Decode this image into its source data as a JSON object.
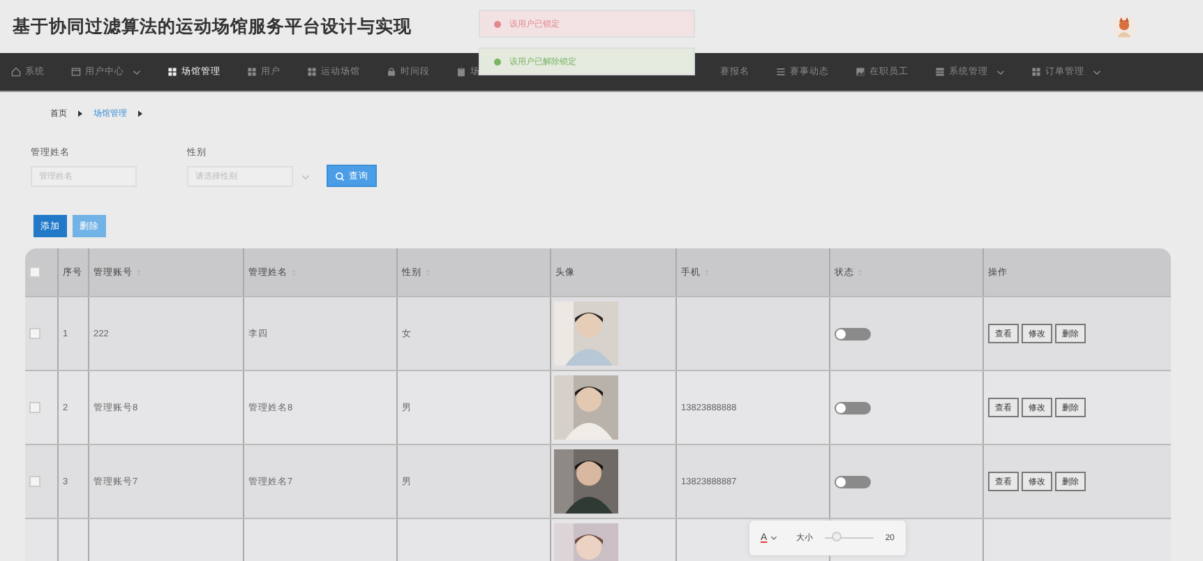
{
  "header": {
    "title": "基于协同过滤算法的运动场馆服务平台设计与实现",
    "avatar": {
      "kind": "picture"
    }
  },
  "nav": [
    {
      "label": "系统",
      "dropdown": false,
      "selected": false
    },
    {
      "label": "用户中心",
      "dropdown": true,
      "selected": false
    },
    {
      "label": "场馆管理",
      "dropdown": false,
      "selected": true
    },
    {
      "label": "用户",
      "dropdown": false,
      "selected": false
    },
    {
      "label": "运动场馆",
      "dropdown": false,
      "selected": false
    },
    {
      "label": "时间段",
      "dropdown": false,
      "selected": false
    },
    {
      "label": "场",
      "dropdown": false,
      "selected": false
    },
    {
      "label": "赛报名",
      "dropdown": false,
      "selected": false
    },
    {
      "label": "赛事动态",
      "dropdown": false,
      "selected": false
    },
    {
      "label": "在职员工",
      "dropdown": false,
      "selected": false
    },
    {
      "label": "系统管理",
      "dropdown": true,
      "selected": false
    },
    {
      "label": "订单管理",
      "dropdown": true,
      "selected": false
    }
  ],
  "toasts": [
    {
      "kind": "error",
      "text": "该用户已锁定"
    },
    {
      "kind": "success",
      "text": "该用户已解除锁定"
    }
  ],
  "breadcrumb": [
    {
      "label": "首页",
      "selected": false
    },
    {
      "label": "场馆管理",
      "selected": true
    }
  ],
  "filters": [
    {
      "kind": "text",
      "label": "管理姓名",
      "placeholder": "管理姓名"
    },
    {
      "kind": "select",
      "label": "性别",
      "placeholder": "请选择性别"
    }
  ],
  "search_button": "查询",
  "actions": [
    {
      "kind": "primary",
      "label": "添加"
    },
    {
      "kind": "light",
      "label": "删除"
    }
  ],
  "table": {
    "select_all": {
      "checked": false
    },
    "columns": [
      {
        "label": "序号",
        "sortable": false
      },
      {
        "label": "管理账号",
        "sortable": true
      },
      {
        "label": "管理姓名",
        "sortable": true
      },
      {
        "label": "性别",
        "sortable": true
      },
      {
        "label": "头像",
        "sortable": false
      },
      {
        "label": "手机",
        "sortable": true
      },
      {
        "label": "状态",
        "sortable": true
      },
      {
        "label": "操作",
        "sortable": false
      }
    ],
    "rows": [
      {
        "checked": false,
        "index": "1",
        "account": "222",
        "name": "李四",
        "gender": "女",
        "avatar": {
          "kind": "picture"
        },
        "on": false,
        "actions": [
          "查看",
          "修改",
          "删除"
        ]
      },
      {
        "checked": false,
        "index": "2",
        "account": "管理账号8",
        "name": "管理姓名8",
        "gender": "男",
        "avatar": {
          "kind": "picture"
        },
        "phone": "13823888888",
        "on": false,
        "actions": [
          "查看",
          "修改",
          "删除"
        ]
      },
      {
        "checked": false,
        "index": "3",
        "account": "管理账号7",
        "name": "管理姓名7",
        "gender": "男",
        "avatar": {
          "kind": "picture"
        },
        "phone": "13823888887",
        "on": false,
        "actions": [
          "查看",
          "修改",
          "删除"
        ]
      },
      {
        "avatar": {
          "kind": "picture"
        }
      }
    ]
  },
  "font_toolbar": {
    "color_label": "A",
    "size_label": "大小",
    "level": 0.25,
    "value": "20"
  }
}
